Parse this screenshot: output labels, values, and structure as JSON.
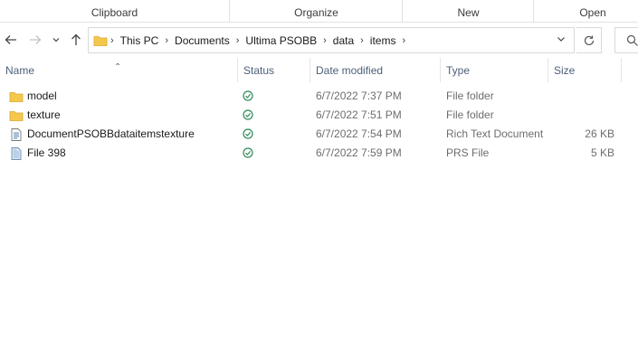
{
  "ribbon": {
    "groups": [
      "Clipboard",
      "Organize",
      "New",
      "Open"
    ]
  },
  "address_bar": {
    "back_icon": "arrow-left-icon",
    "forward_icon": "arrow-right-icon",
    "recent_icon": "chevron-down-icon",
    "up_icon": "arrow-up-icon",
    "crumbs": [
      "This PC",
      "Documents",
      "Ultima PSOBB",
      "data",
      "items"
    ]
  },
  "columns": {
    "name": "Name",
    "status": "Status",
    "date_modified": "Date modified",
    "type": "Type",
    "size": "Size"
  },
  "files": [
    {
      "name": "model",
      "icon": "folder-icon",
      "status": "synced",
      "date": "6/7/2022 7:37 PM",
      "type": "File folder",
      "size": ""
    },
    {
      "name": "texture",
      "icon": "folder-icon",
      "status": "synced",
      "date": "6/7/2022 7:51 PM",
      "type": "File folder",
      "size": ""
    },
    {
      "name": "DocumentPSOBBdataitemstexture",
      "icon": "rtf-document-icon",
      "status": "synced",
      "date": "6/7/2022 7:54 PM",
      "type": "Rich Text Document",
      "size": "26 KB"
    },
    {
      "name": "File 398",
      "icon": "prs-file-icon",
      "status": "synced",
      "date": "6/7/2022 7:59 PM",
      "type": "PRS File",
      "size": "5 KB"
    }
  ],
  "colors": {
    "header_text": "#4c607a",
    "status_ok": "#2e8b57",
    "folder": "#f5c84c"
  }
}
